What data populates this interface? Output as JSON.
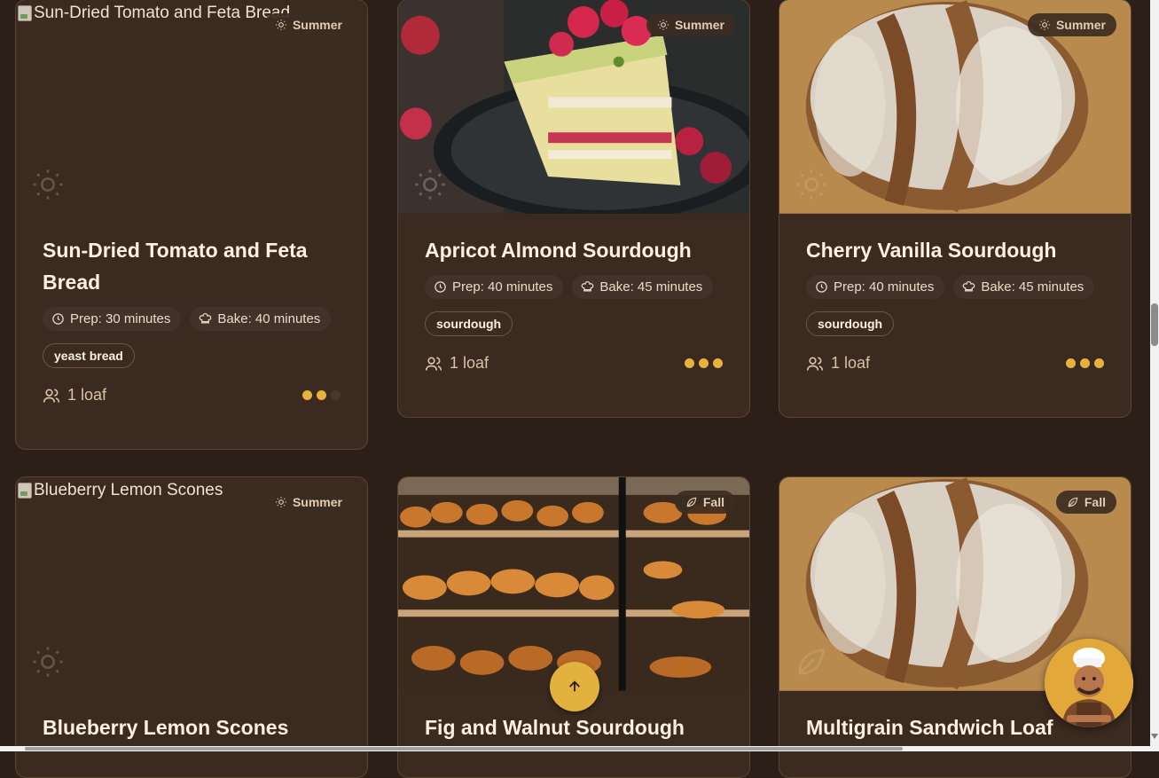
{
  "colors": {
    "page_bg": "#2b1f18",
    "card_bg": "#3a2a20",
    "accent_gold": "#e8b33a",
    "badge_bg": "#3c2c22"
  },
  "cards": [
    {
      "title": "Sun-Dried Tomato and Feta Bread",
      "image_alt": "Sun-Dried Tomato and Feta Bread",
      "image": "broken",
      "season": "Summer",
      "season_icon": "sun-icon",
      "prep": "Prep: 30 minutes",
      "bake": "Bake: 40 minutes",
      "tag": "yeast bread",
      "yield": "1 loaf",
      "difficulty": 2
    },
    {
      "title": "Apricot Almond Sourdough",
      "image": "raspberry-cake-photo",
      "season": "Summer",
      "season_icon": "sun-icon",
      "prep": "Prep: 40 minutes",
      "bake": "Bake: 45 minutes",
      "tag": "sourdough",
      "yield": "1 loaf",
      "difficulty": 3
    },
    {
      "title": "Cherry Vanilla Sourdough",
      "image": "sourdough-loaf-photo",
      "season": "Summer",
      "season_icon": "sun-icon",
      "prep": "Prep: 40 minutes",
      "bake": "Bake: 45 minutes",
      "tag": "sourdough",
      "yield": "1 loaf",
      "difficulty": 3
    },
    {
      "title": "Blueberry Lemon Scones",
      "image_alt": "Blueberry Lemon Scones",
      "image": "broken",
      "season": "Summer",
      "season_icon": "sun-icon"
    },
    {
      "title": "Fig and Walnut Sourdough",
      "image": "bakery-display-photo",
      "season": "Fall",
      "season_icon": "leaf-icon"
    },
    {
      "title": "Multigrain Sandwich Loaf",
      "image": "sourdough-loaf-photo",
      "season": "Fall",
      "season_icon": "leaf-icon"
    }
  ],
  "floating": {
    "scroll_top_icon": "arrow-up-icon",
    "assistant_avatar": "chef-avatar"
  }
}
